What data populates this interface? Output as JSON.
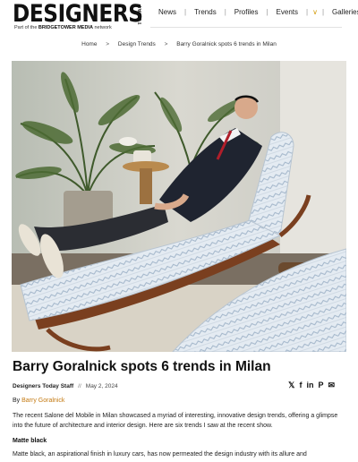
{
  "header": {
    "logo_word": "DESIGNERS",
    "logo_today": "TODAY",
    "logo_partof": "Part of the",
    "logo_network": "BRIDGETOWER MEDIA",
    "logo_network_suffix": "network",
    "nav": [
      {
        "label": "News"
      },
      {
        "label": "Trends"
      },
      {
        "label": "Profiles"
      },
      {
        "label": "Events"
      },
      {
        "label": "Galleries"
      }
    ]
  },
  "breadcrumb": [
    "Home",
    "Design Trends",
    "Barry Goralnick spots 6 trends in Milan"
  ],
  "breadcrumb_sep": ">",
  "article": {
    "title": "Barry Goralnick spots 6 trends in Milan",
    "author": "Designers Today Staff",
    "meta_sep": "//",
    "date": "May 2, 2024",
    "byline_prefix": "By",
    "byline_name": "Barry Goralnick",
    "intro": "The recent Salone del Mobile in Milan showcased a myriad of interesting, innovative design trends, offering a glimpse into the future of architecture and interior design. Here are six trends I saw at the recent show.",
    "subhead": "Matte black",
    "body": "Matte black, an aspirational finish in luxury cars, has now permeated the design industry with its allure and"
  },
  "share": [
    {
      "icon": "x-icon",
      "glyph": "𝕏"
    },
    {
      "icon": "facebook-icon",
      "glyph": "f"
    },
    {
      "icon": "linkedin-icon",
      "glyph": "in"
    },
    {
      "icon": "pinterest-icon",
      "glyph": "P"
    },
    {
      "icon": "email-icon",
      "glyph": "✉"
    }
  ],
  "colors": {
    "accent": "#d4a017",
    "byline_link": "#c47a12",
    "lounger_fabric": "#dfe7ef",
    "lounger_wood": "#8a4b25"
  }
}
